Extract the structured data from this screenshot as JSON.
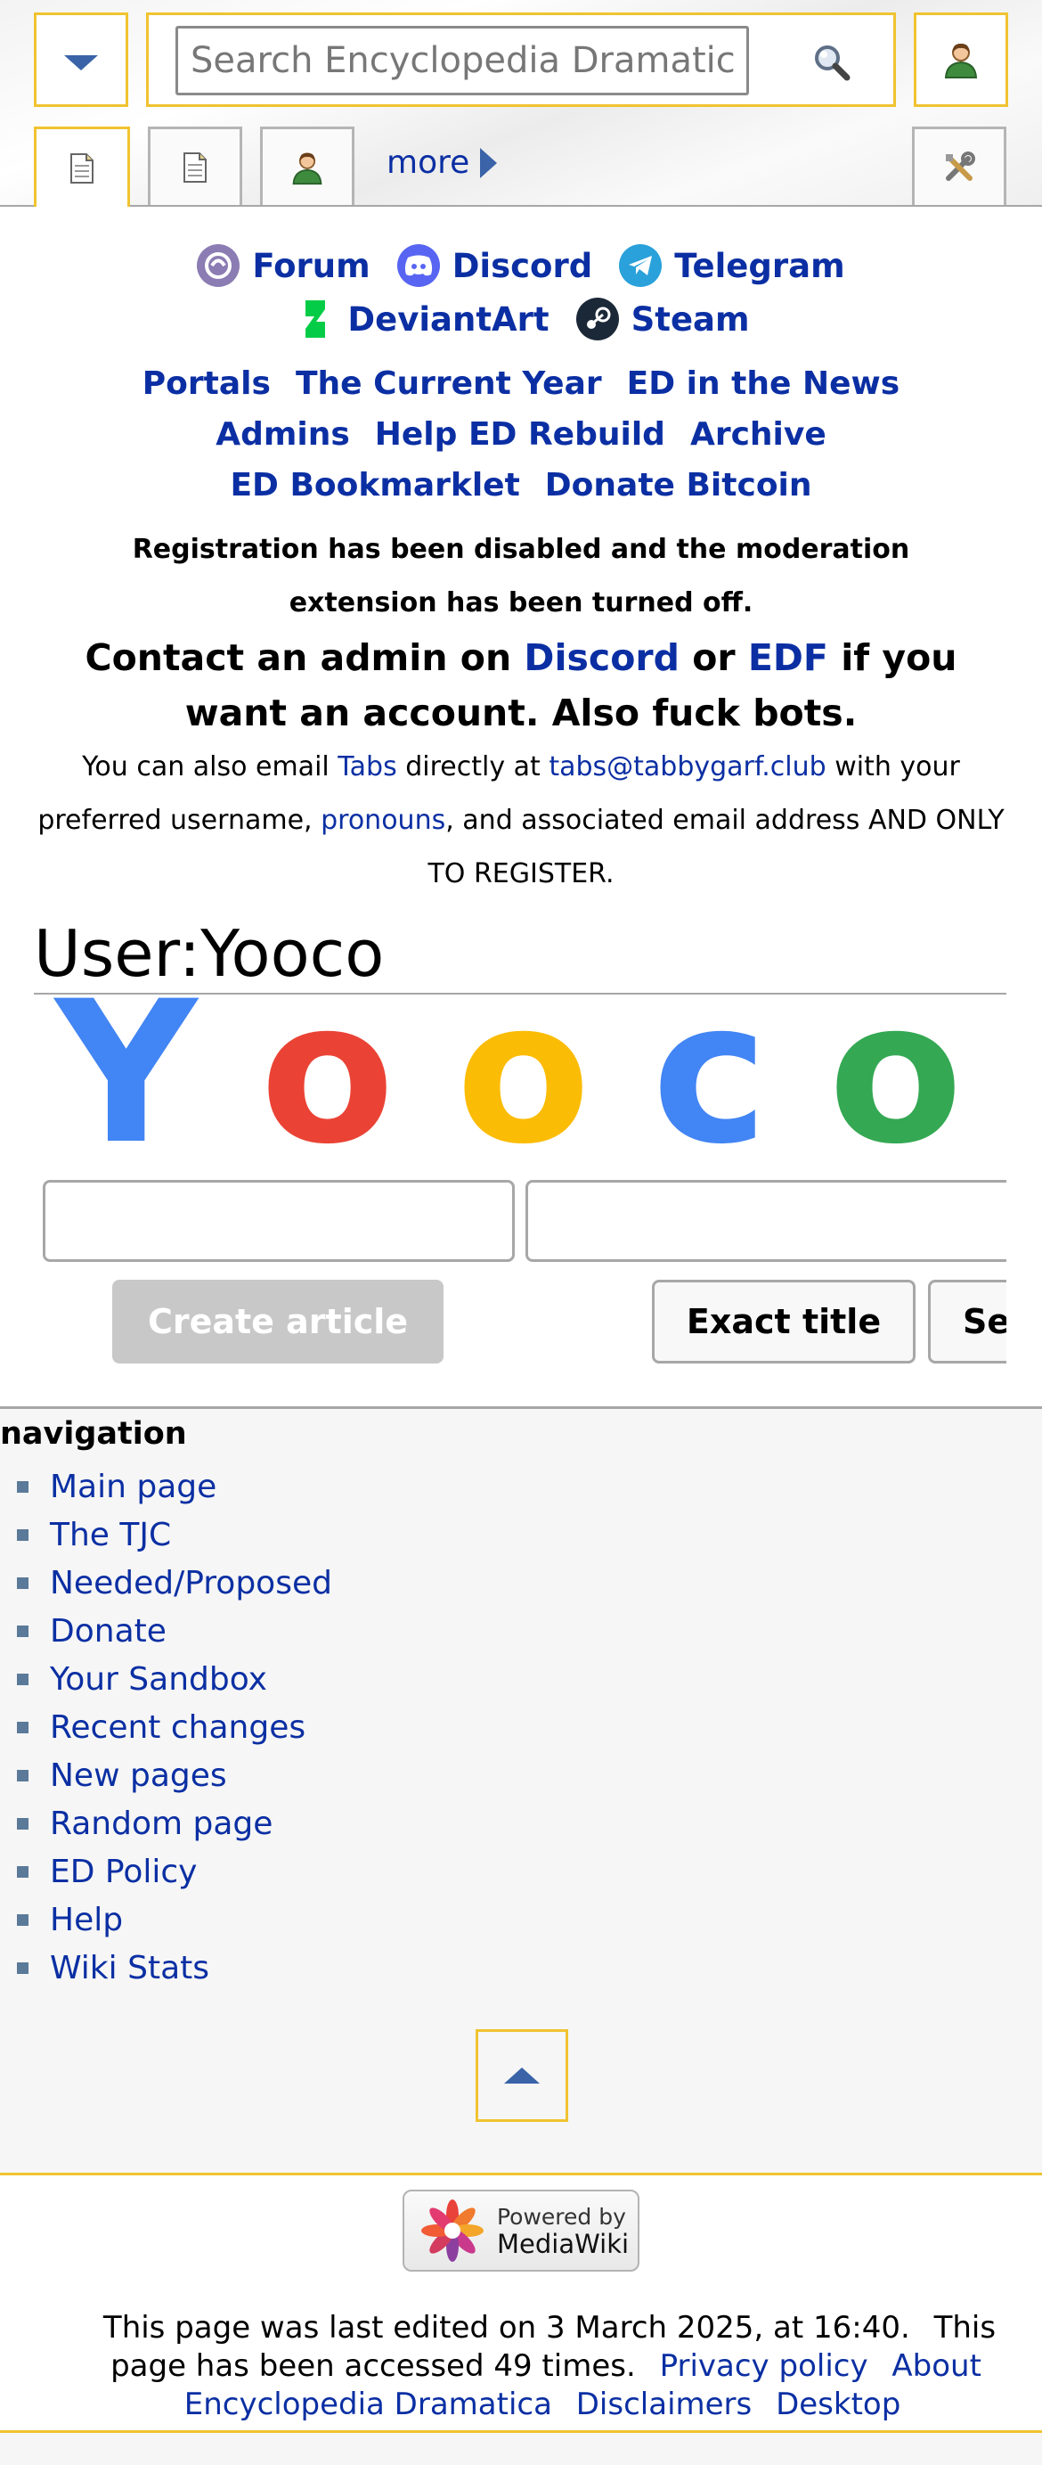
{
  "header": {
    "search_placeholder": "Search Encyclopedia Dramatica",
    "more_label": "more"
  },
  "notice": {
    "social": [
      "Forum",
      "Discord",
      "Telegram",
      "DeviantArt",
      "Steam"
    ],
    "links_row1": [
      "Portals",
      "The Current Year",
      "ED in the News"
    ],
    "links_row2": [
      "Admins",
      "Help ED Rebuild",
      "Archive"
    ],
    "links_row3": [
      "ED Bookmarklet",
      "Donate Bitcoin"
    ],
    "registration": "Registration has been disabled and the moderation extension has been turned off.",
    "contact_prefix": "Contact an admin on ",
    "contact_discord": "Discord",
    "contact_or": " or ",
    "contact_edf": "EDF",
    "contact_suffix": " if you want an account. Also fuck bots.",
    "email_prefix": "You can also email ",
    "email_tabs": "Tabs",
    "email_mid": " directly at ",
    "email_address": "tabs@tabbygarf.club",
    "email_mid2": " with your preferred username, ",
    "email_pronouns": "pronouns",
    "email_suffix": ", and associated email address AND ONLY TO REGISTER."
  },
  "content": {
    "title": "User:Yooco",
    "logo_letters": [
      "Y",
      "o",
      "o",
      "c",
      "o"
    ],
    "logo_colors": [
      "#4285f4",
      "#ea4335",
      "#fbbc05",
      "#4285f4",
      "#34a853"
    ],
    "create_button": "Create article",
    "exact_button": "Exact title",
    "search_button": "Search"
  },
  "navigation": {
    "heading": "navigation",
    "items": [
      "Main page",
      "The TJC",
      "Needed/Proposed",
      "Donate",
      "Your Sandbox",
      "Recent changes",
      "New pages",
      "Random page",
      "ED Policy",
      "Help",
      "Wiki Stats"
    ]
  },
  "footer": {
    "powered_by": "Powered by",
    "mediawiki": "MediaWiki",
    "last_edited": "This page was last edited on 3 March 2025, at 16:40.",
    "accessed": "This page has been accessed 49 times.",
    "links": [
      "Privacy policy",
      "About Encyclopedia Dramatica",
      "Disclaimers",
      "Desktop"
    ]
  }
}
